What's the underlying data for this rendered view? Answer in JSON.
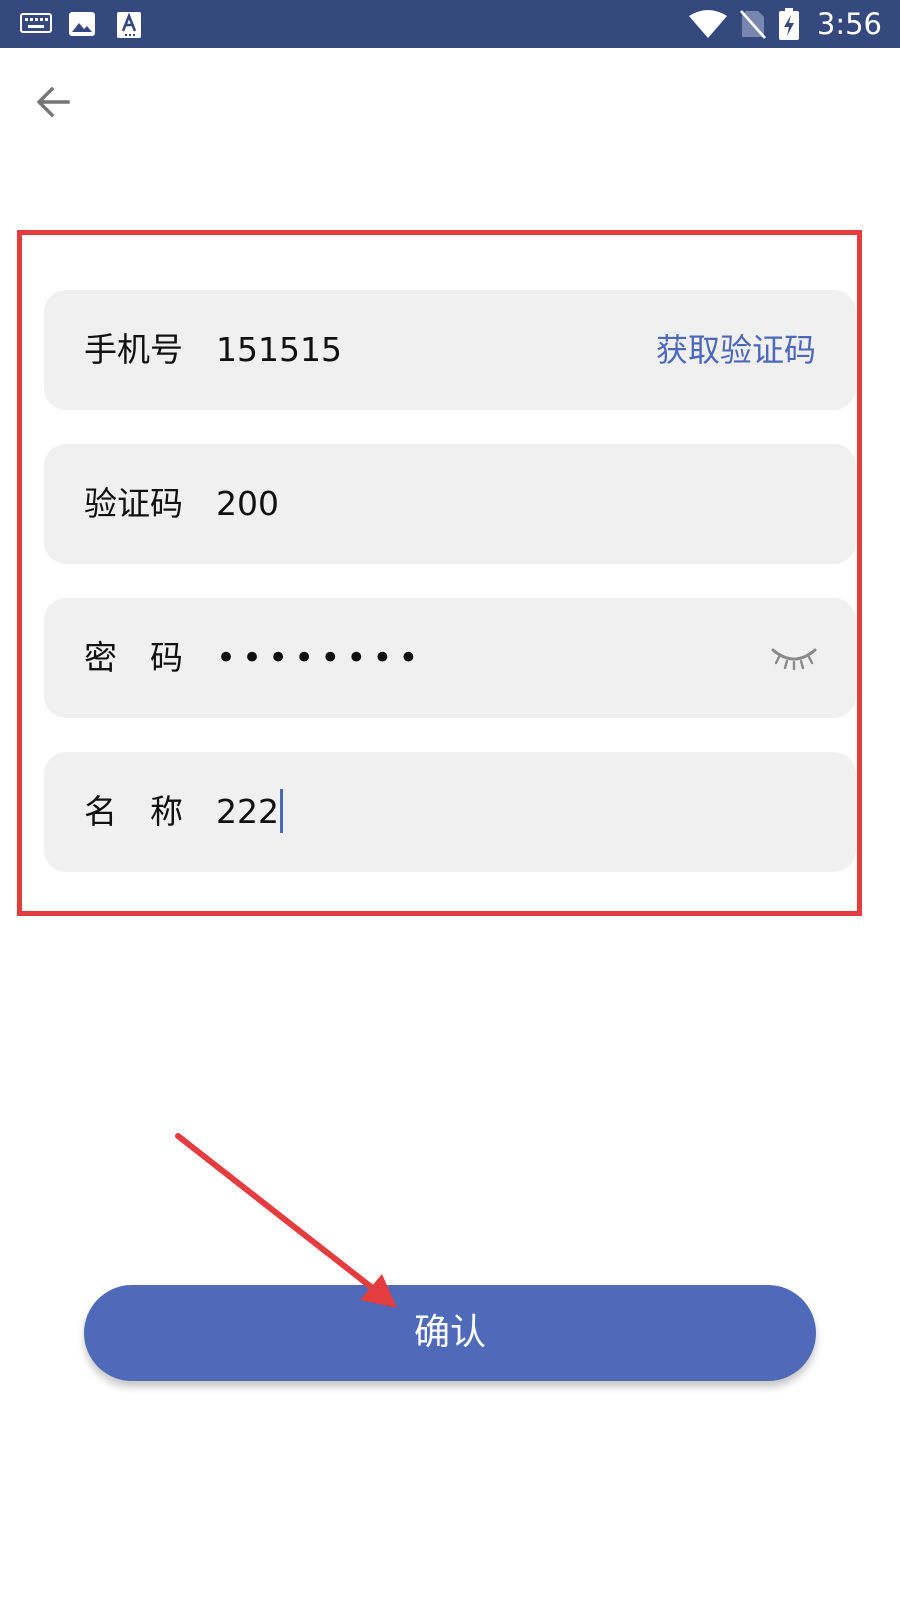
{
  "status_bar": {
    "time": "3:56",
    "left_icons": [
      "keyboard-icon",
      "image-icon",
      "text-a-icon"
    ],
    "right_icons": [
      "wifi-icon",
      "no-sim-icon",
      "battery-charging-icon"
    ]
  },
  "nav": {
    "back_icon": "arrow-left-icon"
  },
  "form": {
    "phone": {
      "label": "手机号",
      "value": "151515",
      "action": "获取验证码"
    },
    "code": {
      "label": "验证码",
      "value": "200"
    },
    "password": {
      "label": "密　码",
      "value": "••••••••",
      "toggle_icon": "eye-closed-icon"
    },
    "name": {
      "label": "名　称",
      "value": "222"
    }
  },
  "confirm_button": {
    "label": "确认"
  },
  "colors": {
    "status_bar": "#35497f",
    "accent": "#4e6ab9",
    "link": "#4d68b8",
    "field_bg": "#f0f0f0",
    "annotation": "#e33d40"
  }
}
